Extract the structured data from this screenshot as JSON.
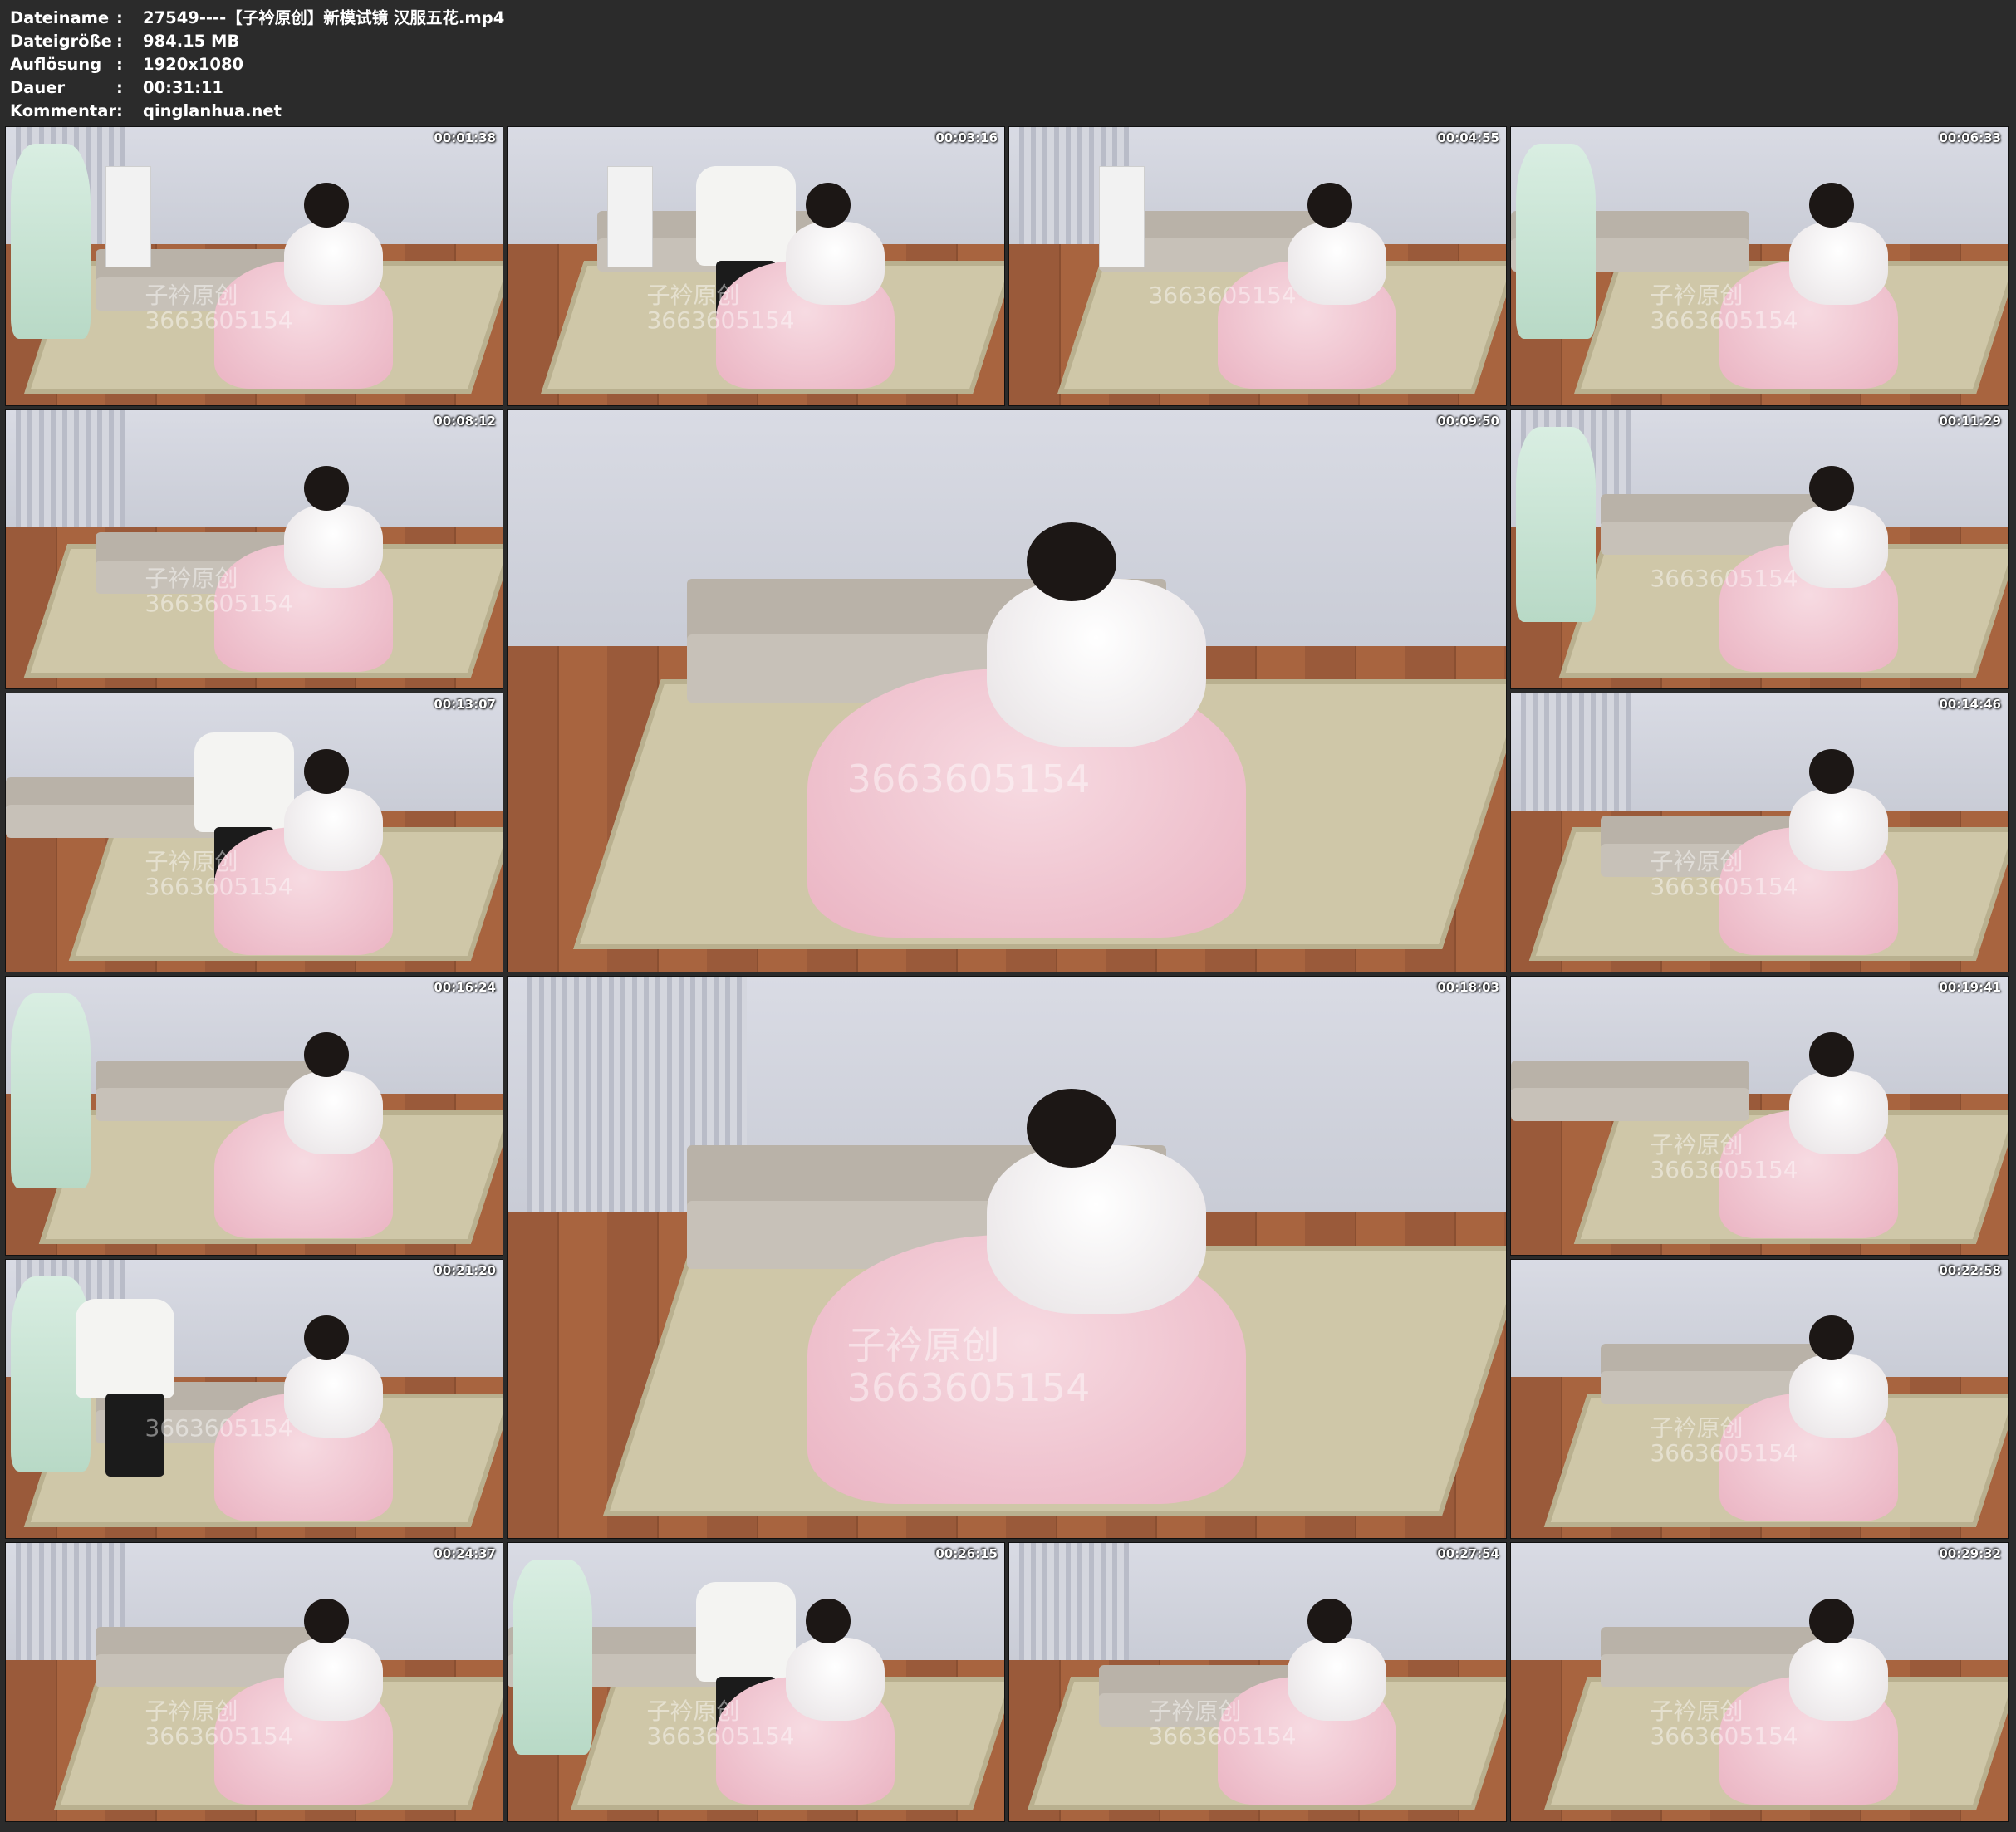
{
  "file_info": {
    "rows": [
      {
        "label": "Dateiname",
        "value": "27549----【子衿原创】新模试镜 汉服五花.mp4"
      },
      {
        "label": "Dateigröße",
        "value": "984.15 MB"
      },
      {
        "label": "Auflösung",
        "value": "1920x1080"
      },
      {
        "label": "Dauer",
        "value": "00:31:11"
      },
      {
        "label": "Kommentar",
        "value": "qinglanhua.net"
      }
    ],
    "separator": ":"
  },
  "colors": {
    "background": "#2b2b2b",
    "text": "#ffffff",
    "rug": "#cfc7a8",
    "floor": "#9a5a3a",
    "hanfu_pink": "#eab3c2",
    "hanfu_green": "#b8d9c6"
  },
  "thumbnails": [
    {
      "timestamp": "00:01:38",
      "watermark": [
        "子衿原创",
        "3663605154"
      ]
    },
    {
      "timestamp": "00:03:16",
      "watermark": [
        "子衿原创",
        "3663605154"
      ]
    },
    {
      "timestamp": "00:04:55",
      "watermark": [
        "",
        "3663605154"
      ]
    },
    {
      "timestamp": "00:06:33",
      "watermark": [
        "子衿原创",
        "3663605154"
      ]
    },
    {
      "timestamp": "00:08:12",
      "watermark": [
        "子衿原创",
        "3663605154"
      ]
    },
    {
      "timestamp": "00:09:50",
      "watermark": [
        "",
        "3663605154"
      ]
    },
    {
      "timestamp": "00:11:29",
      "watermark": [
        "",
        "3663605154"
      ]
    },
    {
      "timestamp": "00:13:07",
      "watermark": [
        "子衿原创",
        "3663605154"
      ]
    },
    {
      "timestamp": "00:14:46",
      "watermark": [
        "子衿原创",
        "3663605154"
      ]
    },
    {
      "timestamp": "00:16:24",
      "watermark": [
        "",
        ""
      ]
    },
    {
      "timestamp": "00:18:03",
      "watermark": [
        "子衿原创",
        "3663605154"
      ]
    },
    {
      "timestamp": "00:19:41",
      "watermark": [
        "子衿原创",
        "3663605154"
      ]
    },
    {
      "timestamp": "00:21:20",
      "watermark": [
        "",
        "3663605154"
      ]
    },
    {
      "timestamp": "00:22:58",
      "watermark": [
        "子衿原创",
        "3663605154"
      ]
    },
    {
      "timestamp": "00:24:37",
      "watermark": [
        "子衿原创",
        "3663605154"
      ]
    },
    {
      "timestamp": "00:26:15",
      "watermark": [
        "子衿原创",
        "3663605154"
      ]
    },
    {
      "timestamp": "00:27:54",
      "watermark": [
        "子衿原创",
        "3663605154"
      ]
    },
    {
      "timestamp": "00:29:32",
      "watermark": [
        "子衿原创",
        "3663605154"
      ]
    }
  ]
}
